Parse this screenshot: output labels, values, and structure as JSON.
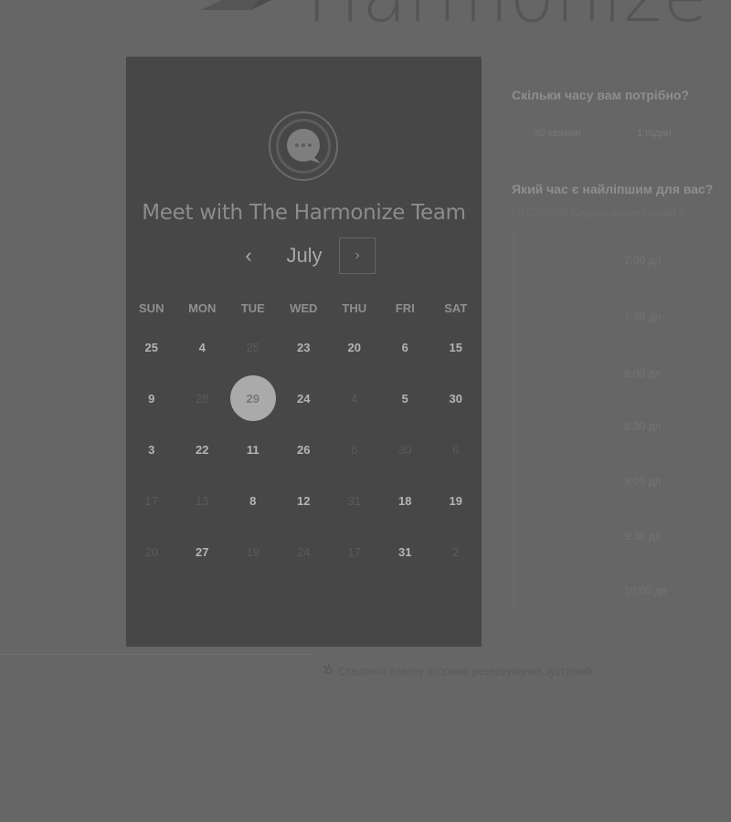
{
  "brand": {
    "name": "Harmonize",
    "logo_icon": "harmonize-mark-icon"
  },
  "panel": {
    "avatar_icon": "chat-bubble-icon",
    "title": "Meet with The Harmonize Team",
    "month": "July",
    "prev_icon": "chevron-left-icon",
    "next_icon": "chevron-right-icon",
    "prev_label": "‹",
    "next_label": "›",
    "weekdays": [
      "SUN",
      "MON",
      "TUE",
      "WED",
      "THU",
      "FRI",
      "SAT"
    ],
    "weeks": [
      [
        {
          "d": "25",
          "dim": false
        },
        {
          "d": "4",
          "dim": false
        },
        {
          "d": "25",
          "dim": true
        },
        {
          "d": "23",
          "dim": false
        },
        {
          "d": "20",
          "dim": false
        },
        {
          "d": "6",
          "dim": false
        },
        {
          "d": "15",
          "dim": false
        }
      ],
      [
        {
          "d": "9",
          "dim": false
        },
        {
          "d": "28",
          "dim": true
        },
        {
          "d": "29",
          "dim": false,
          "selected": true
        },
        {
          "d": "24",
          "dim": false
        },
        {
          "d": "4",
          "dim": true
        },
        {
          "d": "5",
          "dim": false
        },
        {
          "d": "30",
          "dim": false
        }
      ],
      [
        {
          "d": "3",
          "dim": false
        },
        {
          "d": "22",
          "dim": false
        },
        {
          "d": "11",
          "dim": false
        },
        {
          "d": "26",
          "dim": false
        },
        {
          "d": "6",
          "dim": true
        },
        {
          "d": "30",
          "dim": true
        },
        {
          "d": "6",
          "dim": true
        }
      ],
      [
        {
          "d": "17",
          "dim": true
        },
        {
          "d": "13",
          "dim": true
        },
        {
          "d": "8",
          "dim": false
        },
        {
          "d": "12",
          "dim": false
        },
        {
          "d": "31",
          "dim": true
        },
        {
          "d": "18",
          "dim": false
        },
        {
          "d": "19",
          "dim": false
        }
      ],
      [
        {
          "d": "20",
          "dim": true
        },
        {
          "d": "27",
          "dim": false
        },
        {
          "d": "19",
          "dim": true
        },
        {
          "d": "24",
          "dim": true
        },
        {
          "d": "17",
          "dim": true
        },
        {
          "d": "31",
          "dim": false
        },
        {
          "d": "2",
          "dim": true
        }
      ]
    ]
  },
  "duration": {
    "question": "Скільки часу вам потрібно?",
    "options": [
      "30 хвилин",
      "1 годин"
    ]
  },
  "time": {
    "question": "Який час є найліпшим для вас?",
    "timezone_note": "UTC+02:00 Східноєвропейський ч",
    "slots": [
      "7:00 дп",
      "7:30 дп",
      "8:00 дп",
      "8:30 дп",
      "9:00 дп",
      "9:30 дп",
      "10:00 дп"
    ]
  },
  "footer": {
    "icon": "sprocket-icon",
    "link": "Створити власну сторінку резервування зустрічей"
  },
  "colors": {
    "overlay": "#666666",
    "panel": "#474747",
    "selected_day": "#aaaaaa"
  }
}
